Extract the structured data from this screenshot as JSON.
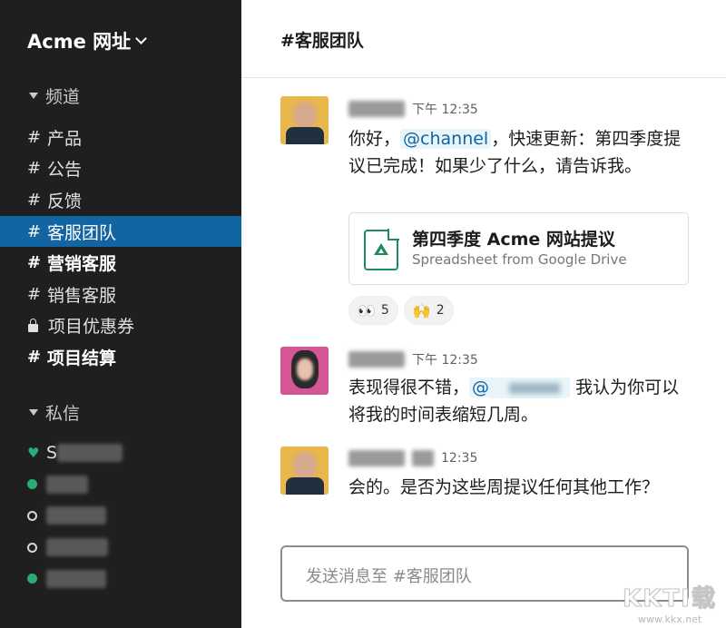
{
  "workspace": {
    "name": "Acme 网址"
  },
  "sidebar": {
    "channels_header": "频道",
    "channels": [
      {
        "label": "产品",
        "icon": "hash-icon",
        "state": "normal"
      },
      {
        "label": "公告",
        "icon": "hash-icon",
        "state": "normal"
      },
      {
        "label": "反馈",
        "icon": "hash-icon",
        "state": "normal"
      },
      {
        "label": "客服团队",
        "icon": "hash-icon",
        "state": "active"
      },
      {
        "label": "营销客服",
        "icon": "hash-icon",
        "state": "unread"
      },
      {
        "label": "销售客服",
        "icon": "hash-icon",
        "state": "normal"
      },
      {
        "label": "项目优惠券",
        "icon": "lock-icon",
        "state": "normal"
      },
      {
        "label": "项目结算",
        "icon": "hash-icon",
        "state": "unread"
      }
    ],
    "dm_header": "私信",
    "dms": [
      {
        "visible_text": "S",
        "presence": "heart"
      },
      {
        "visible_text": "",
        "presence": "online"
      },
      {
        "visible_text": "",
        "presence": "away"
      },
      {
        "visible_text": "",
        "presence": "away"
      },
      {
        "visible_text": "",
        "presence": "online"
      }
    ]
  },
  "main": {
    "channel_title": "#客服团队",
    "messages": [
      {
        "time": "下午 12:35",
        "body_before": "你好，",
        "mention": "@channel",
        "body_after": "，快速更新：第四季度提议已完成！如果少了什么，请告诉我。",
        "attachment": {
          "title": "第四季度 Acme 网站提议",
          "subtitle": "Spreadsheet from Google Drive",
          "icon": "google-drive-sheet-icon"
        },
        "reactions": [
          {
            "emoji": "👀",
            "count": "5"
          },
          {
            "emoji": "🙌",
            "count": "2"
          }
        ]
      },
      {
        "time": "下午 12:35",
        "body_before": "表现得很不错，",
        "mention": "@",
        "body_after": "我认为你可以将我的时间表缩短几周。"
      },
      {
        "time": "12:35",
        "body": "会的。是否为这些周提议任何其他工作？"
      }
    ],
    "composer_placeholder": "发送消息至 #客服团队"
  },
  "watermark": {
    "logo": "KKTI载",
    "url": "www.kkx.net"
  },
  "colors": {
    "sidebar_bg": "#1f1f1f",
    "active_channel": "#1264a3",
    "presence_online": "#2bac76",
    "mention_bg": "#e8f5fa",
    "mention_text": "#1264a3"
  }
}
